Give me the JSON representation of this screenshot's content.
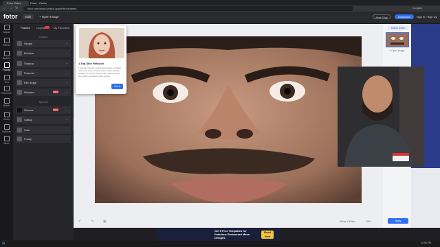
{
  "browser": {
    "tabs": [
      {
        "label": "Fotor Editor"
      },
      {
        "label": "Fotor - Online"
      }
    ],
    "url": "fotor.com/photo-editor-app/editor/frames",
    "profile": "Incognito"
  },
  "header": {
    "logo": "fotor",
    "edit_menu": "Edit",
    "open_image": "Open Image",
    "free_trial": "Free Trial",
    "download": "Download",
    "sign_in": "Sign in / Sign Up"
  },
  "leftnav": [
    {
      "label": "Adjust",
      "icon": "sliders-icon"
    },
    {
      "label": "Effects",
      "icon": "effects-icon"
    },
    {
      "label": "Beauty",
      "icon": "beauty-icon"
    },
    {
      "label": "Frames",
      "icon": "frame-icon",
      "active": true
    },
    {
      "label": "Text",
      "icon": "text-icon"
    },
    {
      "label": "Elements",
      "icon": "elements-icon"
    },
    {
      "label": "Batch",
      "icon": "batch-icon"
    },
    {
      "label": "AI Art",
      "icon": "ai-icon"
    },
    {
      "label": "Uploads",
      "icon": "upload-icon"
    },
    {
      "label": "More",
      "icon": "more-icon"
    }
  ],
  "panel": {
    "tabs": [
      {
        "label": "Frames",
        "active": true
      },
      {
        "label": "Layouts"
      },
      {
        "label": "My Favorites"
      }
    ],
    "sections": [
      {
        "title": "Classic",
        "items": [
          {
            "label": "Simple"
          },
          {
            "label": "Borders"
          },
          {
            "label": "Shadow"
          },
          {
            "label": "Polaroid"
          },
          {
            "label": "Film Edge"
          },
          {
            "label": "Wooden",
            "badge": "NEW"
          }
        ]
      },
      {
        "title": "Special",
        "items": [
          {
            "label": "Scenes",
            "badge": "NEW"
          },
          {
            "label": "Classy"
          },
          {
            "label": "Cute"
          },
          {
            "label": "Funky"
          }
        ]
      }
    ]
  },
  "tooltip": {
    "title": "1-Tap Skin Retouch",
    "description": "1-tap skin retouch seamlessly erases out flaws and acne, removes blemishes, spots, pimples freckles, fine lines, dark circles, and even skin tone while maintaining skin texture.",
    "button": "Got It"
  },
  "right_panel": {
    "switch_editor": "Switch Editor",
    "open_image": "Open Image",
    "apply": "Apply"
  },
  "bottom_bar": {
    "dimensions": "960px x 540px",
    "zoom": "39%"
  },
  "ad": {
    "title": "Get 5 Free Templates for Fabulous Restaurant Menu Designs",
    "button": "Read Now"
  },
  "taskbar": {
    "time": "12:05 PM"
  },
  "colors": {
    "accent": "#2e6ff2",
    "new_badge": "#e53b3b",
    "header_bg": "#2a2a2e",
    "panel_bg": "#25252a"
  }
}
